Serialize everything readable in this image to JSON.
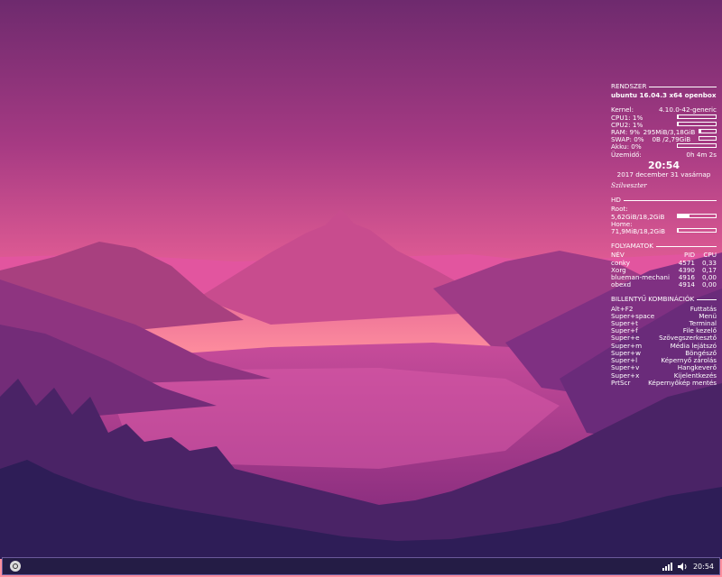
{
  "conky": {
    "system_header": "RENDSZER",
    "distro": "ubuntu 16.04.3 x64 openbox",
    "kernel_label": "Kernel:",
    "kernel_value": "4.10.0-42-generic",
    "cpu1_label": "CPU1: 1%",
    "cpu1_level": 1,
    "cpu2_label": "CPU2: 1%",
    "cpu2_level": 1,
    "ram_label": "RAM: 9%",
    "ram_value": "295MiB/3,18GiB",
    "ram_level": 9,
    "swap_label": "SWAP: 0%",
    "swap_value": "0B /2,79GiB",
    "swap_level": 0,
    "battery_label": "Akku: 0%",
    "battery_level": 0,
    "uptime_label": "Üzemidő:",
    "uptime_value": "0h 4m 2s",
    "clock": "20:54",
    "date": "2017 december 31 vasárnap",
    "signature": "Szilveszter",
    "hd_header": "HD",
    "root_label": "Root:",
    "root_value": "5,62GiB/18,2GiB",
    "root_level": 31,
    "home_label": "Home:",
    "home_value": "71,9MiB/18,2GiB",
    "home_level": 0.4,
    "proc_header": "FOLYAMATOK",
    "proc_columns": [
      "NÉV",
      "PID",
      "CPU"
    ],
    "processes": [
      {
        "name": "conky",
        "pid": "4571",
        "cpu": "0,33"
      },
      {
        "name": "Xorg",
        "pid": "4390",
        "cpu": "0,17"
      },
      {
        "name": "blueman-mechani",
        "pid": "4916",
        "cpu": "0,00"
      },
      {
        "name": "obexd",
        "pid": "4914",
        "cpu": "0,00"
      }
    ],
    "keys_header": "BILLENTYŰ KOMBINÁCIÓK",
    "shortcuts": [
      {
        "keys": "Alt+F2",
        "action": "Futtatás"
      },
      {
        "keys": "Super+space",
        "action": "Menü"
      },
      {
        "keys": "Super+t",
        "action": "Terminal"
      },
      {
        "keys": "Super+f",
        "action": "File kezelő"
      },
      {
        "keys": "Super+e",
        "action": "Szövegszerkesztő"
      },
      {
        "keys": "Super+m",
        "action": "Média lejátszó"
      },
      {
        "keys": "Super+w",
        "action": "Böngésző"
      },
      {
        "keys": "Super+l",
        "action": "Képernyő zárolás"
      },
      {
        "keys": "Super+v",
        "action": "Hangkeverő"
      },
      {
        "keys": "Super+x",
        "action": "Kijelentkezés"
      },
      {
        "keys": "PrtScr",
        "action": "Képernyőkép mentés"
      }
    ]
  },
  "taskbar": {
    "clock": "20:54",
    "icons": [
      "menu-icon",
      "signal-icon",
      "volume-icon"
    ]
  },
  "colors": {
    "sky_top": "#6e2a6e",
    "sky_mid": "#c94b8e",
    "horizon": "#ff9aa8",
    "taskbar_bg": "#241c45"
  }
}
